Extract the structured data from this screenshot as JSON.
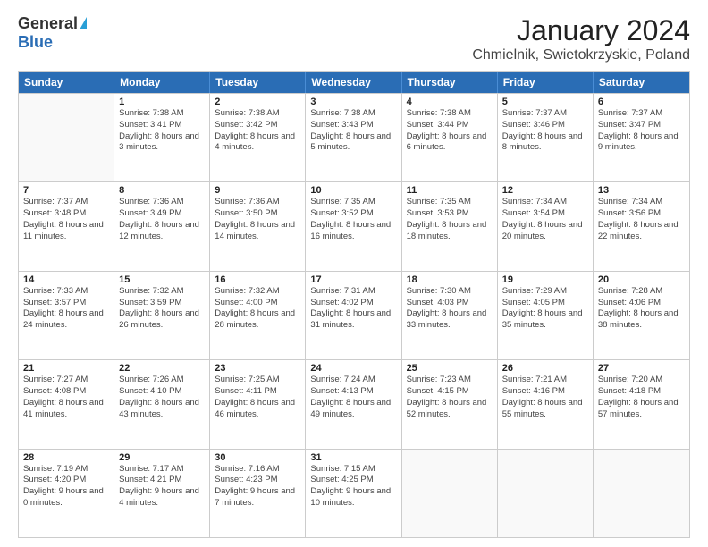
{
  "logo": {
    "general": "General",
    "blue": "Blue"
  },
  "title": "January 2024",
  "location": "Chmielnik, Swietokrzyskie, Poland",
  "header_days": [
    "Sunday",
    "Monday",
    "Tuesday",
    "Wednesday",
    "Thursday",
    "Friday",
    "Saturday"
  ],
  "weeks": [
    [
      {
        "day": "",
        "sunrise": "",
        "sunset": "",
        "daylight": ""
      },
      {
        "day": "1",
        "sunrise": "Sunrise: 7:38 AM",
        "sunset": "Sunset: 3:41 PM",
        "daylight": "Daylight: 8 hours and 3 minutes."
      },
      {
        "day": "2",
        "sunrise": "Sunrise: 7:38 AM",
        "sunset": "Sunset: 3:42 PM",
        "daylight": "Daylight: 8 hours and 4 minutes."
      },
      {
        "day": "3",
        "sunrise": "Sunrise: 7:38 AM",
        "sunset": "Sunset: 3:43 PM",
        "daylight": "Daylight: 8 hours and 5 minutes."
      },
      {
        "day": "4",
        "sunrise": "Sunrise: 7:38 AM",
        "sunset": "Sunset: 3:44 PM",
        "daylight": "Daylight: 8 hours and 6 minutes."
      },
      {
        "day": "5",
        "sunrise": "Sunrise: 7:37 AM",
        "sunset": "Sunset: 3:46 PM",
        "daylight": "Daylight: 8 hours and 8 minutes."
      },
      {
        "day": "6",
        "sunrise": "Sunrise: 7:37 AM",
        "sunset": "Sunset: 3:47 PM",
        "daylight": "Daylight: 8 hours and 9 minutes."
      }
    ],
    [
      {
        "day": "7",
        "sunrise": "Sunrise: 7:37 AM",
        "sunset": "Sunset: 3:48 PM",
        "daylight": "Daylight: 8 hours and 11 minutes."
      },
      {
        "day": "8",
        "sunrise": "Sunrise: 7:36 AM",
        "sunset": "Sunset: 3:49 PM",
        "daylight": "Daylight: 8 hours and 12 minutes."
      },
      {
        "day": "9",
        "sunrise": "Sunrise: 7:36 AM",
        "sunset": "Sunset: 3:50 PM",
        "daylight": "Daylight: 8 hours and 14 minutes."
      },
      {
        "day": "10",
        "sunrise": "Sunrise: 7:35 AM",
        "sunset": "Sunset: 3:52 PM",
        "daylight": "Daylight: 8 hours and 16 minutes."
      },
      {
        "day": "11",
        "sunrise": "Sunrise: 7:35 AM",
        "sunset": "Sunset: 3:53 PM",
        "daylight": "Daylight: 8 hours and 18 minutes."
      },
      {
        "day": "12",
        "sunrise": "Sunrise: 7:34 AM",
        "sunset": "Sunset: 3:54 PM",
        "daylight": "Daylight: 8 hours and 20 minutes."
      },
      {
        "day": "13",
        "sunrise": "Sunrise: 7:34 AM",
        "sunset": "Sunset: 3:56 PM",
        "daylight": "Daylight: 8 hours and 22 minutes."
      }
    ],
    [
      {
        "day": "14",
        "sunrise": "Sunrise: 7:33 AM",
        "sunset": "Sunset: 3:57 PM",
        "daylight": "Daylight: 8 hours and 24 minutes."
      },
      {
        "day": "15",
        "sunrise": "Sunrise: 7:32 AM",
        "sunset": "Sunset: 3:59 PM",
        "daylight": "Daylight: 8 hours and 26 minutes."
      },
      {
        "day": "16",
        "sunrise": "Sunrise: 7:32 AM",
        "sunset": "Sunset: 4:00 PM",
        "daylight": "Daylight: 8 hours and 28 minutes."
      },
      {
        "day": "17",
        "sunrise": "Sunrise: 7:31 AM",
        "sunset": "Sunset: 4:02 PM",
        "daylight": "Daylight: 8 hours and 31 minutes."
      },
      {
        "day": "18",
        "sunrise": "Sunrise: 7:30 AM",
        "sunset": "Sunset: 4:03 PM",
        "daylight": "Daylight: 8 hours and 33 minutes."
      },
      {
        "day": "19",
        "sunrise": "Sunrise: 7:29 AM",
        "sunset": "Sunset: 4:05 PM",
        "daylight": "Daylight: 8 hours and 35 minutes."
      },
      {
        "day": "20",
        "sunrise": "Sunrise: 7:28 AM",
        "sunset": "Sunset: 4:06 PM",
        "daylight": "Daylight: 8 hours and 38 minutes."
      }
    ],
    [
      {
        "day": "21",
        "sunrise": "Sunrise: 7:27 AM",
        "sunset": "Sunset: 4:08 PM",
        "daylight": "Daylight: 8 hours and 41 minutes."
      },
      {
        "day": "22",
        "sunrise": "Sunrise: 7:26 AM",
        "sunset": "Sunset: 4:10 PM",
        "daylight": "Daylight: 8 hours and 43 minutes."
      },
      {
        "day": "23",
        "sunrise": "Sunrise: 7:25 AM",
        "sunset": "Sunset: 4:11 PM",
        "daylight": "Daylight: 8 hours and 46 minutes."
      },
      {
        "day": "24",
        "sunrise": "Sunrise: 7:24 AM",
        "sunset": "Sunset: 4:13 PM",
        "daylight": "Daylight: 8 hours and 49 minutes."
      },
      {
        "day": "25",
        "sunrise": "Sunrise: 7:23 AM",
        "sunset": "Sunset: 4:15 PM",
        "daylight": "Daylight: 8 hours and 52 minutes."
      },
      {
        "day": "26",
        "sunrise": "Sunrise: 7:21 AM",
        "sunset": "Sunset: 4:16 PM",
        "daylight": "Daylight: 8 hours and 55 minutes."
      },
      {
        "day": "27",
        "sunrise": "Sunrise: 7:20 AM",
        "sunset": "Sunset: 4:18 PM",
        "daylight": "Daylight: 8 hours and 57 minutes."
      }
    ],
    [
      {
        "day": "28",
        "sunrise": "Sunrise: 7:19 AM",
        "sunset": "Sunset: 4:20 PM",
        "daylight": "Daylight: 9 hours and 0 minutes."
      },
      {
        "day": "29",
        "sunrise": "Sunrise: 7:17 AM",
        "sunset": "Sunset: 4:21 PM",
        "daylight": "Daylight: 9 hours and 4 minutes."
      },
      {
        "day": "30",
        "sunrise": "Sunrise: 7:16 AM",
        "sunset": "Sunset: 4:23 PM",
        "daylight": "Daylight: 9 hours and 7 minutes."
      },
      {
        "day": "31",
        "sunrise": "Sunrise: 7:15 AM",
        "sunset": "Sunset: 4:25 PM",
        "daylight": "Daylight: 9 hours and 10 minutes."
      },
      {
        "day": "",
        "sunrise": "",
        "sunset": "",
        "daylight": ""
      },
      {
        "day": "",
        "sunrise": "",
        "sunset": "",
        "daylight": ""
      },
      {
        "day": "",
        "sunrise": "",
        "sunset": "",
        "daylight": ""
      }
    ]
  ]
}
